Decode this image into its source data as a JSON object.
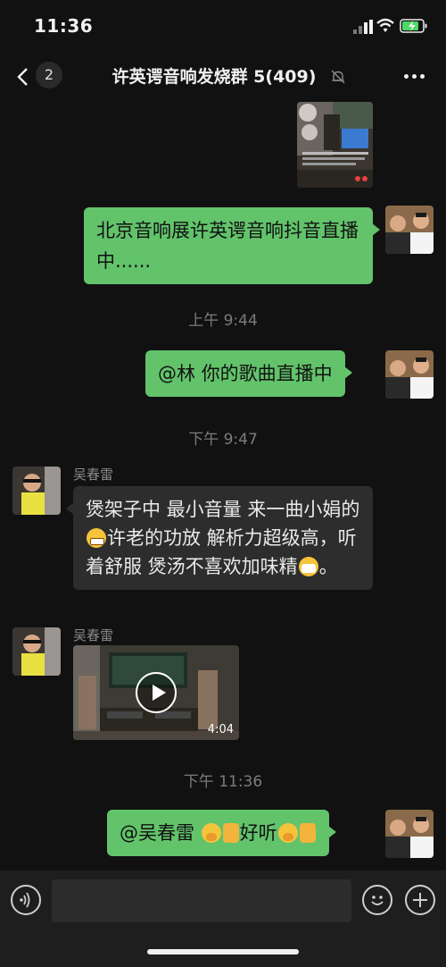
{
  "status_bar": {
    "time": "11:36"
  },
  "nav": {
    "unread_count": "2",
    "title": "许英谔音响发烧群 5(409)"
  },
  "messages": {
    "outgoing_1": "北京音响展许英谔音响抖音直播中......",
    "time_1": "上午 9:44",
    "outgoing_2": "@林 你的歌曲直播中",
    "time_2": "下午 9:47",
    "sender_1": "吴春雷",
    "incoming_1_part1": "煲架子中 最小音量 来一曲小娟的",
    "incoming_1_part2": "许老的功放 解析力超级高，听着舒服 煲汤不喜欢加味精",
    "incoming_1_part3": "。",
    "sender_2": "吴春雷",
    "video_duration": "4:04",
    "time_3": "下午 11:36",
    "outgoing_3_text1": "@吴春雷 ",
    "outgoing_3_text2": "好听"
  },
  "icons": {
    "signal": "signal-icon",
    "wifi": "wifi-icon",
    "battery": "battery-charging-icon",
    "mute": "bell-slash-icon",
    "voice": "voice-icon",
    "emoji": "smiley-icon",
    "add": "plus-icon"
  },
  "colors": {
    "outgoing_bubble": "#62c36b",
    "incoming_bubble": "#2d2d2d",
    "background": "#111111"
  }
}
